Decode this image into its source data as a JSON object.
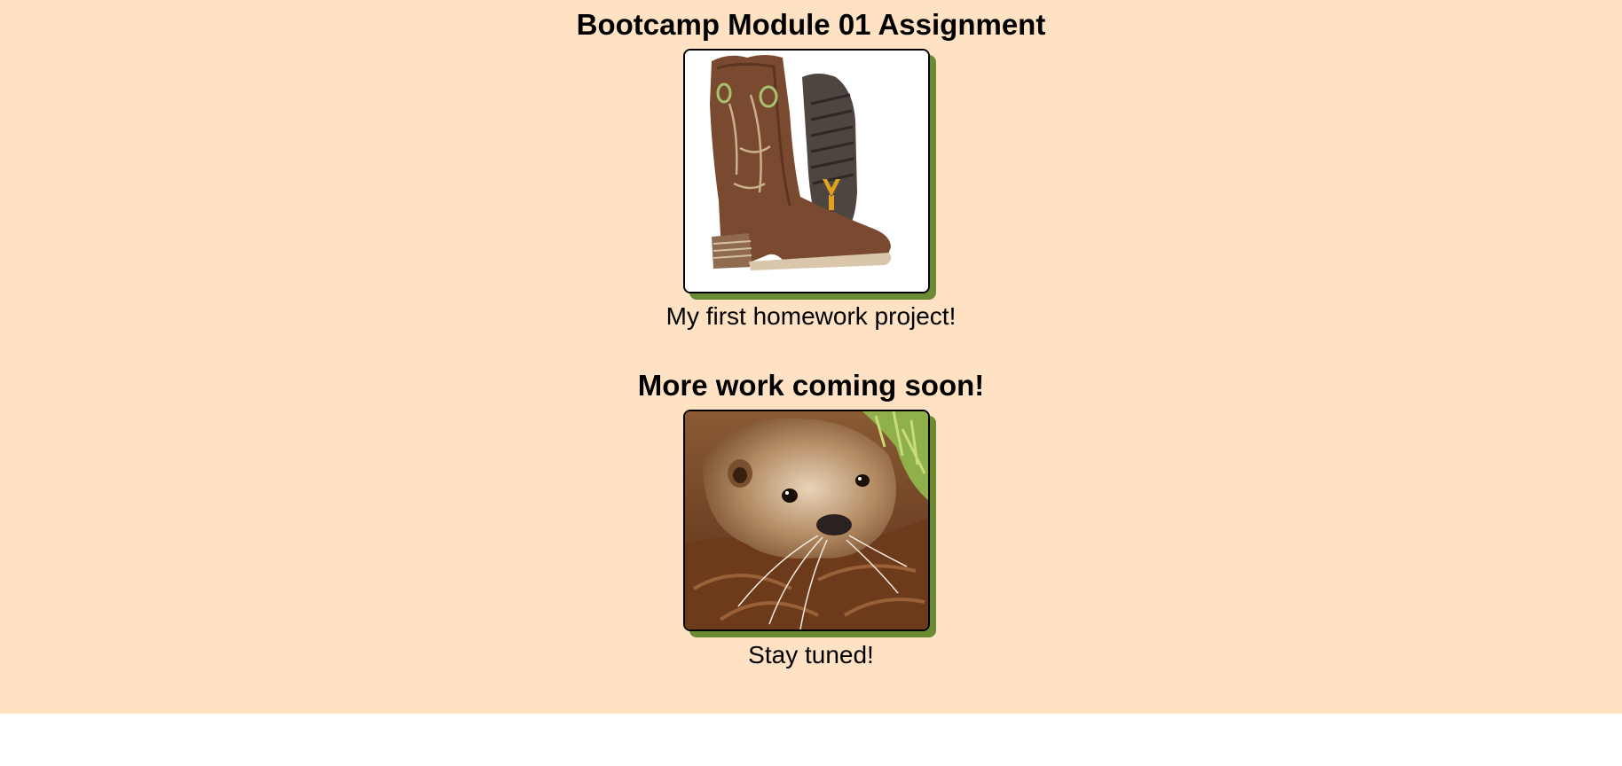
{
  "title": "Bootcamp Module 01 Assignment",
  "sections": [
    {
      "image_subject": "cowboy-boot",
      "caption": "My first homework project!"
    },
    {
      "heading": "More work coming soon!",
      "image_subject": "otter",
      "caption": "Stay tuned!"
    }
  ],
  "colors": {
    "page_background": "#ffe2c3",
    "image_shadow": "#6a8a34",
    "image_border": "#000000"
  }
}
